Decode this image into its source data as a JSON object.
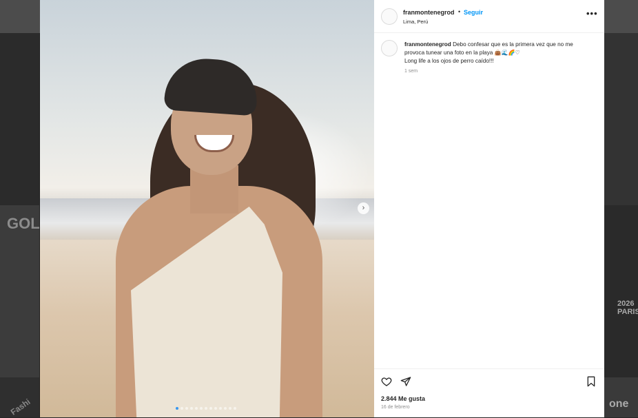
{
  "post": {
    "username": "franmontenegrod",
    "separator": "•",
    "follow_label": "Seguir",
    "location": "Lima, Perú",
    "more_label": "•••",
    "caption": {
      "username": "franmontenegrod",
      "line1": "Debo confesar que es la primera vez que no me provoca tunear una foto en la playa",
      "emojis": "👜🌊🌈♡",
      "line2": "Long life a los ojos de perro caído!!!"
    },
    "caption_time": "1 sem",
    "likes": "2.844 Me gusta",
    "date": "16 de febrero",
    "carousel": {
      "count": 13,
      "active_index": 0
    }
  },
  "background": {
    "tile_text_gold": "GOLD",
    "tile_text_paris": "2026 PARIS",
    "tile_text_one": "one",
    "tile_text_fashion": "Fashi"
  },
  "colors": {
    "follow": "#0095f6",
    "overlay": "#1e1e1e",
    "active_dot": "#3897f0"
  },
  "icons": [
    "heart-icon",
    "share-icon",
    "bookmark-icon",
    "chevron-right-icon",
    "more-icon"
  ]
}
